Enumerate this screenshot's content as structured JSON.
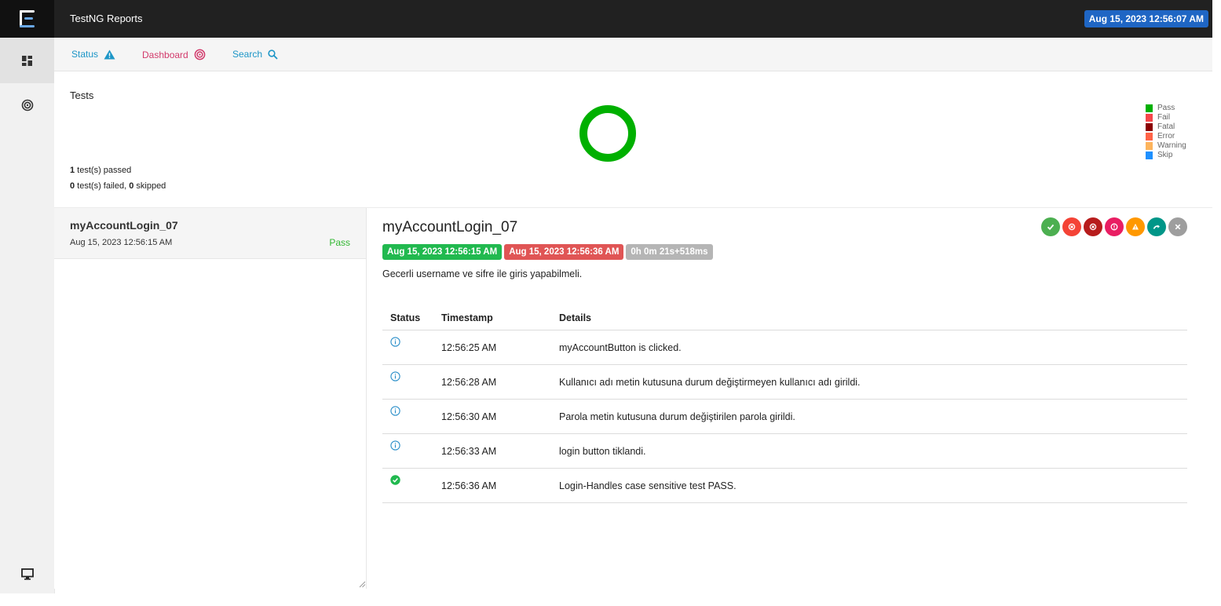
{
  "app": {
    "title": "TestNG Reports",
    "report_date": "Aug 15, 2023 12:56:07 AM"
  },
  "rail": {
    "items": [
      {
        "icon": "dashboard-grid-icon",
        "active": true
      },
      {
        "icon": "target-icon",
        "active": false
      },
      {
        "icon": "monitor-icon",
        "active": false
      }
    ]
  },
  "nav": {
    "status_label": "Status",
    "dashboard_label": "Dashboard",
    "search_label": "Search",
    "status_color": "#1d96c7",
    "dashboard_color": "#d23a6b"
  },
  "dashboard": {
    "title": "Tests",
    "passed_count": "1",
    "passed_text": " test(s) passed",
    "failed_count": "0",
    "failed_text": " test(s) failed, ",
    "skipped_count": "0",
    "skipped_text": " skipped",
    "legend": [
      {
        "label": "Pass",
        "color": "#00b000"
      },
      {
        "label": "Fail",
        "color": "#f7464a"
      },
      {
        "label": "Fatal",
        "color": "#8b0000"
      },
      {
        "label": "Error",
        "color": "#ff6347"
      },
      {
        "label": "Warning",
        "color": "#fdb45c"
      },
      {
        "label": "Skip",
        "color": "#1e90ff"
      }
    ]
  },
  "chart_data": {
    "type": "pie",
    "categories": [
      "Pass",
      "Fail",
      "Fatal",
      "Error",
      "Warning",
      "Skip"
    ],
    "values": [
      1,
      0,
      0,
      0,
      0,
      0
    ],
    "legend_position": "right"
  },
  "test_list": [
    {
      "name": "myAccountLogin_07",
      "time": "Aug 15, 2023 12:56:15 AM",
      "status": "Pass"
    }
  ],
  "detail": {
    "name": "myAccountLogin_07",
    "start_time": "Aug 15, 2023 12:56:15 AM",
    "end_time": "Aug 15, 2023 12:56:36 AM",
    "duration": "0h 0m 21s+518ms",
    "description": "Gecerli username ve sifre ile giris yapabilmeli.",
    "columns": {
      "status": "Status",
      "timestamp": "Timestamp",
      "details": "Details"
    },
    "filters": [
      {
        "icon": "check-icon",
        "color": "#4caf50"
      },
      {
        "icon": "fail-x-icon",
        "color": "#f44336"
      },
      {
        "icon": "fatal-x-icon",
        "color": "#b71c1c"
      },
      {
        "icon": "error-exclamation-icon",
        "color": "#e91e63"
      },
      {
        "icon": "warning-icon",
        "color": "#ff9800"
      },
      {
        "icon": "skip-arrow-icon",
        "color": "#009688"
      },
      {
        "icon": "clear-x-icon",
        "color": "#9e9e9e"
      }
    ],
    "logs": [
      {
        "status": "info",
        "timestamp": "12:56:25 AM",
        "details": "myAccountButton is clicked."
      },
      {
        "status": "info",
        "timestamp": "12:56:28 AM",
        "details": "Kullanıcı adı metin kutusuna durum değiştirmeyen kullanıcı adı girildi."
      },
      {
        "status": "info",
        "timestamp": "12:56:30 AM",
        "details": "Parola metin kutusuna durum değiştirilen parola girildi."
      },
      {
        "status": "info",
        "timestamp": "12:56:33 AM",
        "details": "login button tiklandi."
      },
      {
        "status": "pass",
        "timestamp": "12:56:36 AM",
        "details": "Login-Handles case sensitive test PASS."
      }
    ]
  }
}
